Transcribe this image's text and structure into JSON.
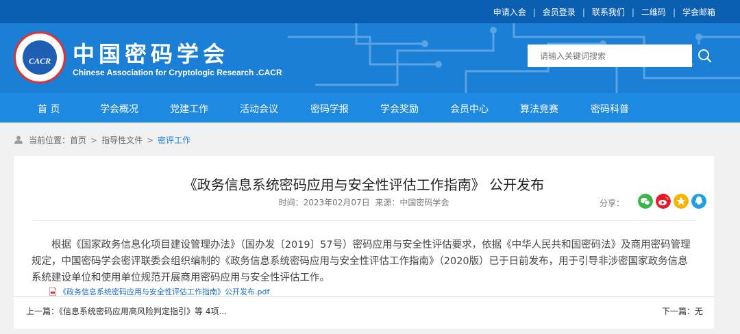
{
  "topbar": {
    "links": [
      "申请入会",
      "会员登录",
      "联系我们",
      "二维码",
      "学会邮箱"
    ],
    "separator": "|"
  },
  "header": {
    "logo_text": "CACR",
    "title_cn": "中国密码学会",
    "title_en": "Chinese Association for Cryptologic Research .CACR",
    "search_placeholder": "请输入关键词搜索"
  },
  "nav": {
    "items": [
      "首 页",
      "学会概况",
      "党建工作",
      "活动会议",
      "密码学报",
      "学会奖励",
      "会员中心",
      "算法竞赛",
      "密码科普"
    ]
  },
  "breadcrumb": {
    "prefix": "当前位置：",
    "items": [
      "首页",
      "指导性文件",
      "密评工作"
    ],
    "separator": ">"
  },
  "article": {
    "title": "《政务信息系统密码应用与安全性评估工作指南》 公开发布",
    "time_label": "时间：",
    "time": "2023年02月07日",
    "source_label": "来源：",
    "source": "中国密码学会",
    "share_label": "分享：",
    "body": "根据《国家政务信息化项目建设管理办法》（国办发〔2019〕57号）密码应用与安全性评估要求，依据《中华人民共和国密码法》及商用密码管理规定，中国密码学会密评联委会组织编制的《政务信息系统密码应用与安全性评估工作指南》（2020版）已于日前发布，用于引导非涉密国家政务信息系统建设单位和使用单位规范开展商用密码应用与安全性评估工作。",
    "attachment": "《政务信息系统密码应用与安全性评估工作指南》公开发布.pdf",
    "prev_label": "上一篇：",
    "prev_title": "《信息系统密码应用高风险判定指引》等 4项...",
    "next_label": "下一篇：",
    "next_title": "无"
  },
  "colors": {
    "topbar": "#0b5fb0",
    "banner": "#1b7fd6",
    "nav": "#1d89e0",
    "link": "#1b7fd6"
  }
}
